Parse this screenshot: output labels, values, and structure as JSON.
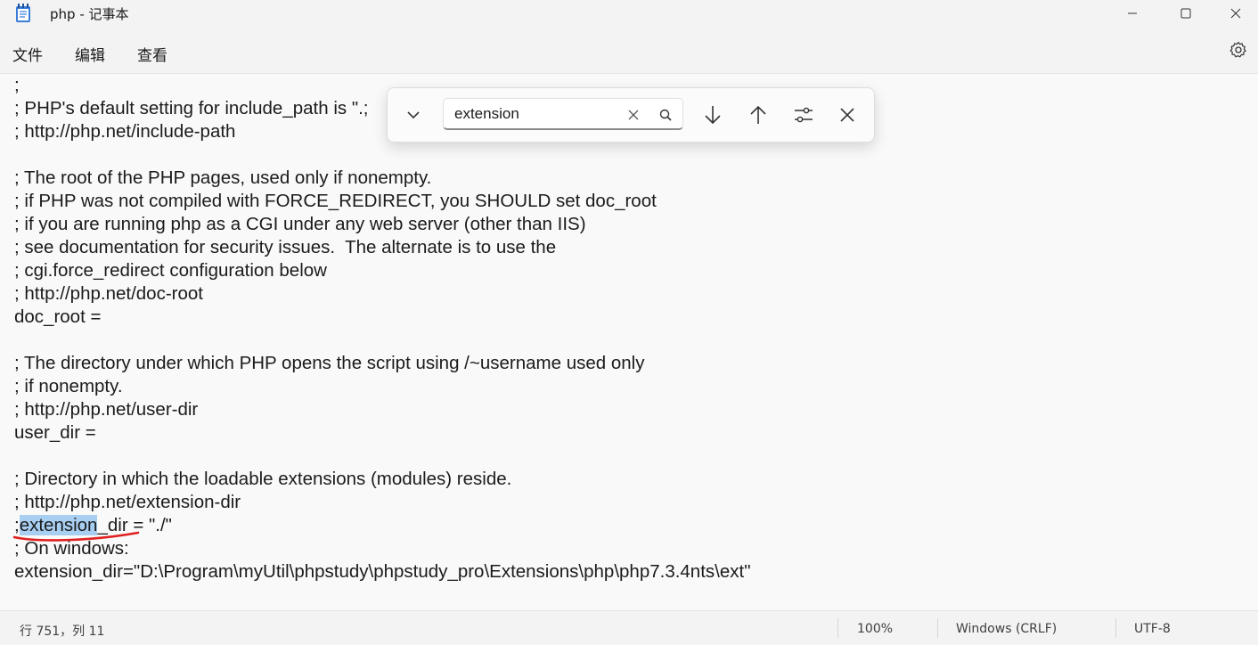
{
  "window": {
    "title": "php - 记事本",
    "minimize_icon": "minimize-icon",
    "maximize_icon": "maximize-icon",
    "close_icon": "close-icon"
  },
  "menu": {
    "file": "文件",
    "edit": "编辑",
    "view": "查看",
    "settings_icon": "gear-icon"
  },
  "find_panel": {
    "expand_icon": "chevron-down-icon",
    "query": "extension",
    "clear_icon": "close-icon",
    "search_icon": "search-icon",
    "next_icon": "arrow-down-icon",
    "prev_icon": "arrow-up-icon",
    "options_icon": "sliders-icon",
    "close_icon": "close-icon"
  },
  "editor": {
    "lines": [
      ";",
      "; PHP's default setting for include_path is \".;",
      "; http://php.net/include-path",
      "",
      "; The root of the PHP pages, used only if nonempty.",
      "; if PHP was not compiled with FORCE_REDIRECT, you SHOULD set doc_root",
      "; if you are running php as a CGI under any web server (other than IIS)",
      "; see documentation for security issues.  The alternate is to use the",
      "; cgi.force_redirect configuration below",
      "; http://php.net/doc-root",
      "doc_root =",
      "",
      "; The directory under which PHP opens the script using /~username used only",
      "; if nonempty.",
      "; http://php.net/user-dir",
      "user_dir =",
      "",
      "; Directory in which the loadable extensions (modules) reside.",
      "; http://php.net/extension-dir",
      "",
      "; On windows:",
      "extension_dir=\"D:\\Program\\myUtil\\phpstudy\\phpstudy_pro\\Extensions\\php\\php7.3.4nts\\ext\""
    ],
    "match_line": {
      "prefix": ";",
      "match": "extension",
      "suffix": "_dir = \"./\""
    },
    "annotation_color": "#e02020",
    "selection_color": "#a8cff2"
  },
  "status_bar": {
    "position": "行 751，列 11",
    "zoom": "100%",
    "line_ending": "Windows (CRLF)",
    "encoding": "UTF-8"
  }
}
